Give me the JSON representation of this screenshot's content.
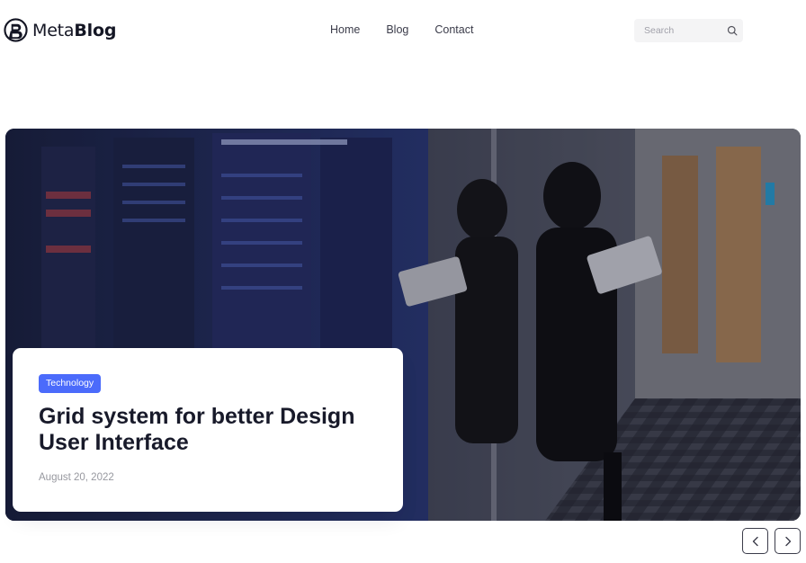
{
  "brand": {
    "prefix": "Meta",
    "suffix": "Blog"
  },
  "nav": {
    "items": [
      {
        "label": "Home"
      },
      {
        "label": "Blog"
      },
      {
        "label": "Contact"
      }
    ]
  },
  "search": {
    "placeholder": "Search",
    "value": ""
  },
  "featured": {
    "category": "Technology",
    "title": "Grid system for better Design User Interface",
    "date": "August 20, 2022"
  },
  "colors": {
    "accent": "#4b6bfb",
    "text": "#181a2a",
    "muted": "#97989f",
    "search_bg": "#f4f4f5"
  },
  "icons": {
    "search": "search-icon",
    "prev": "chevron-left-icon",
    "next": "chevron-right-icon",
    "logo": "logo-mark-icon"
  }
}
